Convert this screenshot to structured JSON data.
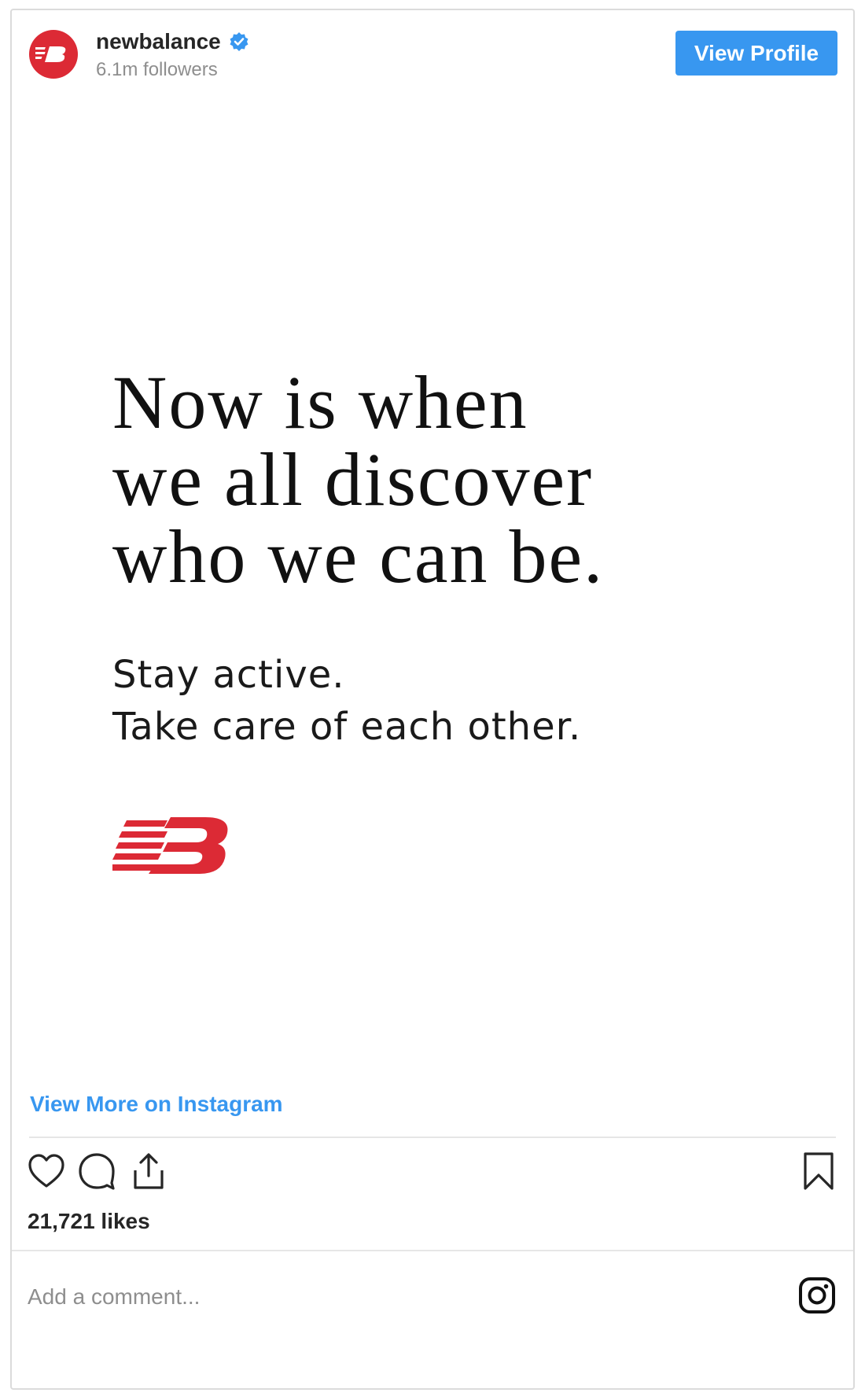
{
  "header": {
    "account_name": "newbalance",
    "followers": "6.1m followers",
    "view_profile_label": "View Profile"
  },
  "post": {
    "headline_lines": [
      "Now is when",
      "we all discover",
      "who we can be."
    ],
    "subtext_lines": [
      "Stay active.",
      "Take care of each other."
    ],
    "logo_text": "NB"
  },
  "links": {
    "view_more": "View More on Instagram"
  },
  "engagement": {
    "likes": "21,721 likes"
  },
  "comment": {
    "placeholder": "Add a comment..."
  },
  "colors": {
    "brand_red": "#dc2a35",
    "accent_blue": "#3897f0",
    "verified_blue": "#3897f0"
  },
  "icons": {
    "heart": "heart-icon",
    "comment": "comment-icon",
    "share": "share-icon",
    "bookmark": "bookmark-icon",
    "instagram": "instagram-icon",
    "verified": "verified-badge-icon"
  }
}
